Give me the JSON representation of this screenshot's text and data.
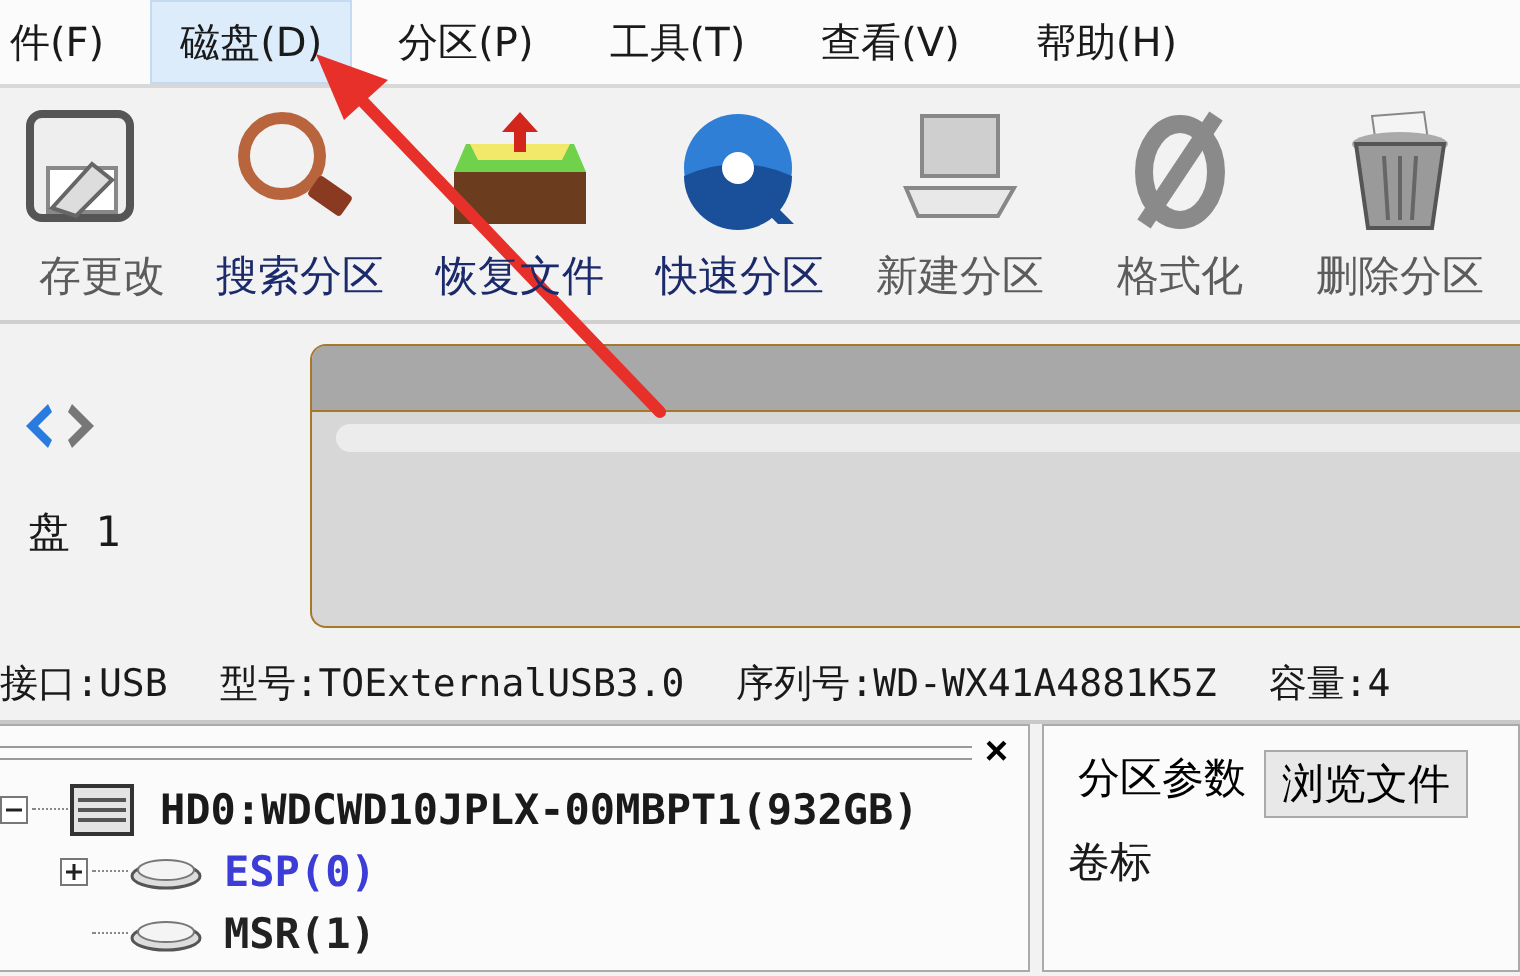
{
  "menu": [
    {
      "label": "件(F)",
      "selected": false
    },
    {
      "label": "磁盘(D)",
      "selected": true
    },
    {
      "label": "分区(P)",
      "selected": false
    },
    {
      "label": "工具(T)",
      "selected": false
    },
    {
      "label": "查看(V)",
      "selected": false
    },
    {
      "label": "帮助(H)",
      "selected": false
    }
  ],
  "toolbar": [
    {
      "label": "存更改",
      "kind": "save",
      "disabled": true
    },
    {
      "label": "搜索分区",
      "kind": "search",
      "disabled": false
    },
    {
      "label": "恢复文件",
      "kind": "restore",
      "disabled": false
    },
    {
      "label": "快速分区",
      "kind": "quick",
      "disabled": false
    },
    {
      "label": "新建分区",
      "kind": "new",
      "disabled": true
    },
    {
      "label": "格式化",
      "kind": "format",
      "disabled": true
    },
    {
      "label": "删除分区",
      "kind": "delete",
      "disabled": true
    }
  ],
  "disk_label": "盘 1",
  "disk_info": [
    "接口:USB",
    "型号:TOExternalUSB3.0",
    "序列号:WD-WX41A4881K5Z",
    "容量:4"
  ],
  "tree": {
    "label": "HD0:WDCWD10JPLX-00MBPT1(932GB)",
    "expanded": true,
    "children": [
      {
        "label": "ESP(0)",
        "color": "#3c3cd6",
        "expanded": false
      },
      {
        "label": "MSR(1)",
        "color": "#222222"
      }
    ]
  },
  "panel_close": "×",
  "tabs": [
    {
      "label": "分区参数",
      "selected": true
    },
    {
      "label": "浏览文件",
      "selected": false
    }
  ],
  "field_label": "卷标"
}
